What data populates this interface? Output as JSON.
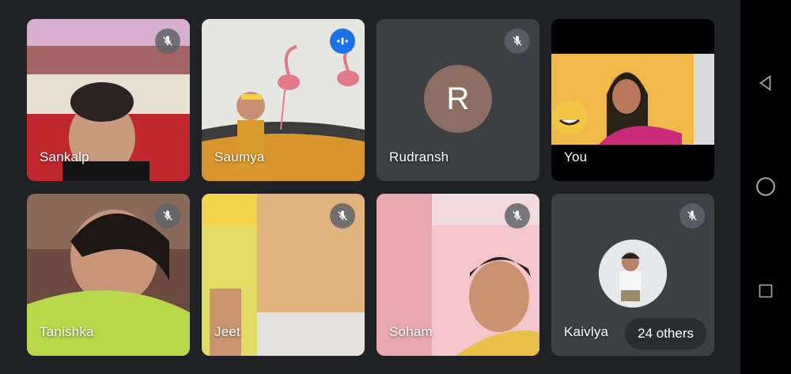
{
  "participants": [
    {
      "name": "Sankalp",
      "mic": "muted"
    },
    {
      "name": "Saumya",
      "mic": "speaking"
    },
    {
      "name": "Rudransh",
      "mic": "muted",
      "avatar_letter": "R",
      "avatar_color": "#8d6e63"
    },
    {
      "name": "You",
      "mic": "none"
    },
    {
      "name": "Tanishka",
      "mic": "muted"
    },
    {
      "name": "Jeet",
      "mic": "muted"
    },
    {
      "name": "Soham",
      "mic": "muted"
    },
    {
      "name": "Kaivlya",
      "mic": "muted"
    }
  ],
  "others_chip": "24 others",
  "colors": {
    "background": "#202124",
    "tile": "#3c4043",
    "speaking_badge": "#1a73e8"
  },
  "system_nav": {
    "back": "back-icon",
    "home": "home-icon",
    "recents": "recents-icon"
  }
}
